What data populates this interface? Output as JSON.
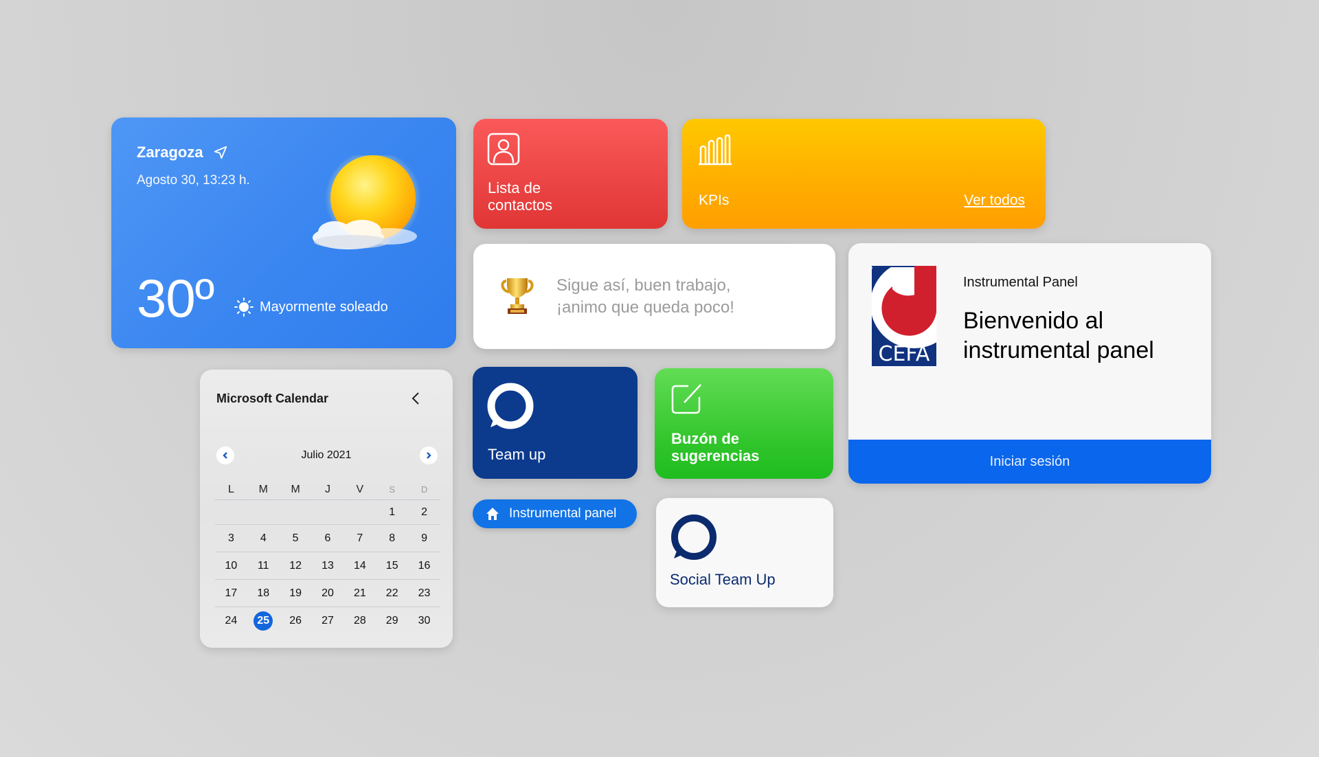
{
  "colors": {
    "weather_bg": "#3a86f0",
    "contacts_bg": "#e84444",
    "kpis_bg": "#ffb400",
    "teamup_bg": "#0c3a8d",
    "buzon_bg": "#2fc42a",
    "primary_blue": "#0a66ec",
    "today_highlight": "#1366db",
    "cefa_red": "#d0202e",
    "cefa_navy": "#10327f"
  },
  "weather": {
    "city": "Zaragoza",
    "location_icon": "navigation-arrow-icon",
    "datetime": "Agosto 30, 13:23 h.",
    "temperature": "30º",
    "condition": "Mayormente soleado",
    "condition_icon": "sun-icon",
    "illustration": "sun-behind-cloud-icon"
  },
  "contacts": {
    "icon": "contact-card-icon",
    "label_line1": "Lista de",
    "label_line2": "contactos"
  },
  "kpis": {
    "icon": "bar-chart-icon",
    "label": "KPIs",
    "link": "Ver todos"
  },
  "motivation": {
    "icon": "trophy-icon",
    "line1": "Sigue así, buen trabajo,",
    "line2": "¡animo que queda poco!"
  },
  "cefa_panel": {
    "logo_text": "CEFA",
    "subtitle": "Instrumental Panel",
    "title_line1": "Bienvenido al",
    "title_line2": "instrumental panel",
    "login_button": "Iniciar sesión"
  },
  "calendar": {
    "title": "Microsoft Calendar",
    "month": "Julio 2021",
    "weekdays": [
      "L",
      "M",
      "M",
      "J",
      "V",
      "S",
      "D"
    ],
    "weeks": [
      [
        "",
        "",
        "",
        "",
        "",
        "1",
        "2"
      ],
      [
        "3",
        "4",
        "5",
        "6",
        "7",
        "8",
        "9"
      ],
      [
        "10",
        "11",
        "12",
        "13",
        "14",
        "15",
        "16"
      ],
      [
        "17",
        "18",
        "19",
        "20",
        "21",
        "22",
        "23"
      ],
      [
        "24",
        "25",
        "26",
        "27",
        "28",
        "29",
        "30"
      ]
    ],
    "selected_day": "25"
  },
  "teamup": {
    "icon": "chat-ring-icon",
    "label": "Team up"
  },
  "buzon": {
    "icon": "edit-square-icon",
    "label_line1": "Buzón de",
    "label_line2": "sugerencias"
  },
  "home_pill": {
    "icon": "home-icon",
    "label": "Instrumental panel"
  },
  "social": {
    "icon": "chat-ring-icon",
    "label": "Social Team Up"
  }
}
